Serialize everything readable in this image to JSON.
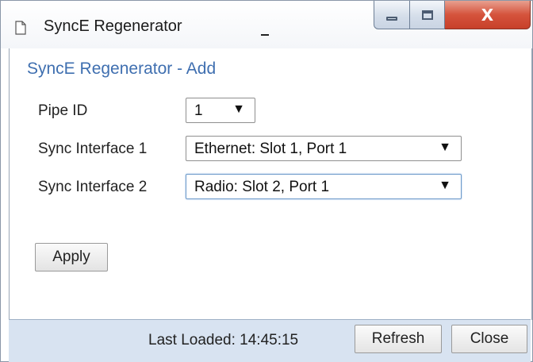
{
  "window": {
    "title": "SyncE Regenerator",
    "controls": {
      "minimize_icon": "minimize-icon",
      "maximize_icon": "maximize-icon",
      "close_label": "X"
    }
  },
  "dialog": {
    "heading": "SyncE Regenerator - Add",
    "fields": {
      "pipe_id": {
        "label": "Pipe ID",
        "value": "1"
      },
      "sync_interface_1": {
        "label": "Sync Interface 1",
        "value": "Ethernet: Slot 1, Port 1"
      },
      "sync_interface_2": {
        "label": "Sync Interface 2",
        "value": "Radio: Slot 2, Port 1"
      }
    },
    "dropdown_arrow": "▼",
    "apply_label": "Apply"
  },
  "footer": {
    "last_loaded": "Last Loaded: 14:45:15",
    "refresh_label": "Refresh",
    "close_label": "Close"
  },
  "colors": {
    "heading": "#3f6fb0",
    "footer_bg": "#d8e3f1",
    "close_button": "#c7402a"
  }
}
